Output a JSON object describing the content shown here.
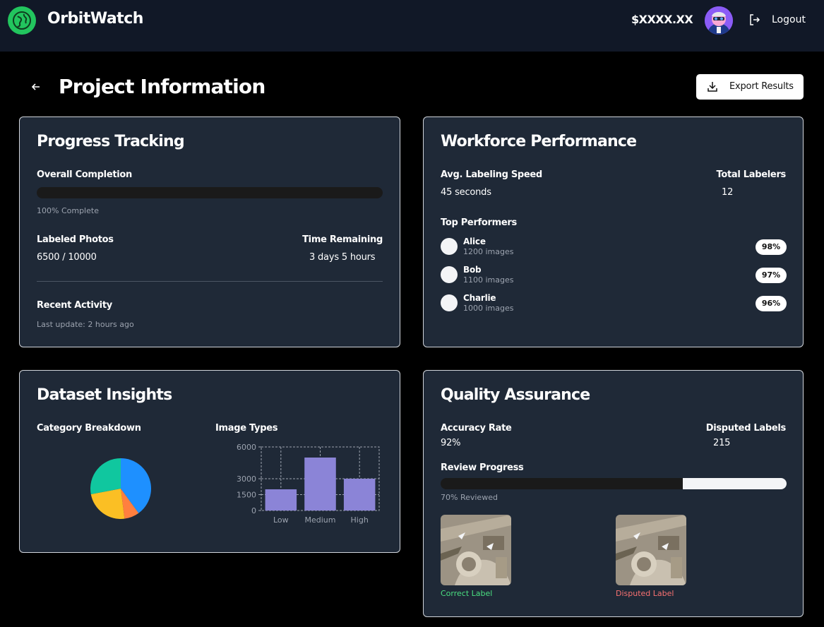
{
  "header": {
    "brand": "OrbitWatch",
    "balance": "$XXXX.XX",
    "logout_label": "Logout"
  },
  "page": {
    "title": "Project Information",
    "export_label": "Export Results"
  },
  "progress": {
    "title": "Progress Tracking",
    "overall_label": "Overall Completion",
    "overall_status": "100% Complete",
    "labeled_label": "Labeled Photos",
    "labeled_value": "6500 / 10000",
    "time_label": "Time Remaining",
    "time_value": "3 days 5 hours",
    "activity_label": "Recent Activity",
    "activity_value": "Last update: 2 hours ago"
  },
  "workforce": {
    "title": "Workforce Performance",
    "speed_label": "Avg. Labeling Speed",
    "speed_value": "45 seconds",
    "labelers_label": "Total Labelers",
    "labelers_value": "12",
    "top_label": "Top Performers",
    "performers": [
      {
        "name": "Alice",
        "images": "1200 images",
        "score": "98%"
      },
      {
        "name": "Bob",
        "images": "1100 images",
        "score": "97%"
      },
      {
        "name": "Charlie",
        "images": "1000 images",
        "score": "96%"
      }
    ]
  },
  "insights": {
    "title": "Dataset Insights",
    "category_label": "Category Breakdown",
    "types_label": "Image Types"
  },
  "chart_data": [
    {
      "type": "pie",
      "title": "Category Breakdown",
      "slices": [
        {
          "value": 40,
          "color": "#1e90ff"
        },
        {
          "value": 8,
          "color": "#ff7f3f"
        },
        {
          "value": 24,
          "color": "#fbbf24"
        },
        {
          "value": 28,
          "color": "#10c79f"
        }
      ]
    },
    {
      "type": "bar",
      "title": "Image Types",
      "categories": [
        "Low",
        "Medium",
        "High"
      ],
      "values": [
        2000,
        5000,
        3000
      ],
      "yticks": [
        0,
        1500,
        3000,
        6000
      ],
      "ylim": [
        0,
        6000
      ],
      "grid": true,
      "bar_color": "#8b84d7"
    }
  ],
  "quality": {
    "title": "Quality Assurance",
    "accuracy_label": "Accuracy Rate",
    "accuracy_value": "92%",
    "disputed_label": "Disputed Labels",
    "disputed_value": "215",
    "review_label": "Review Progress",
    "review_status": "70% Reviewed",
    "review_fraction": 0.7,
    "correct_caption": "Correct Label",
    "disputed_caption": "Disputed Label"
  }
}
